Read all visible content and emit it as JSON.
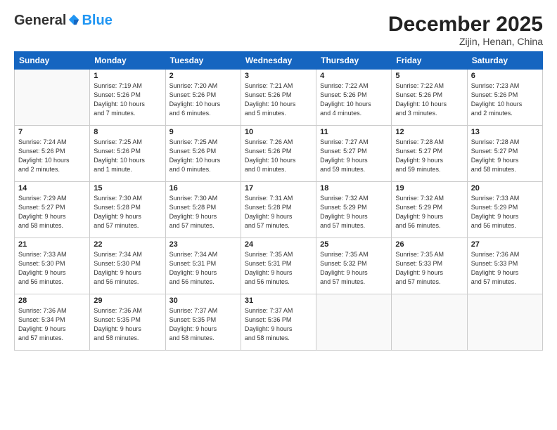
{
  "header": {
    "logo_general": "General",
    "logo_blue": "Blue",
    "month": "December 2025",
    "location": "Zijin, Henan, China"
  },
  "weekdays": [
    "Sunday",
    "Monday",
    "Tuesday",
    "Wednesday",
    "Thursday",
    "Friday",
    "Saturday"
  ],
  "weeks": [
    [
      {
        "day": "",
        "info": ""
      },
      {
        "day": "1",
        "info": "Sunrise: 7:19 AM\nSunset: 5:26 PM\nDaylight: 10 hours\nand 7 minutes."
      },
      {
        "day": "2",
        "info": "Sunrise: 7:20 AM\nSunset: 5:26 PM\nDaylight: 10 hours\nand 6 minutes."
      },
      {
        "day": "3",
        "info": "Sunrise: 7:21 AM\nSunset: 5:26 PM\nDaylight: 10 hours\nand 5 minutes."
      },
      {
        "day": "4",
        "info": "Sunrise: 7:22 AM\nSunset: 5:26 PM\nDaylight: 10 hours\nand 4 minutes."
      },
      {
        "day": "5",
        "info": "Sunrise: 7:22 AM\nSunset: 5:26 PM\nDaylight: 10 hours\nand 3 minutes."
      },
      {
        "day": "6",
        "info": "Sunrise: 7:23 AM\nSunset: 5:26 PM\nDaylight: 10 hours\nand 2 minutes."
      }
    ],
    [
      {
        "day": "7",
        "info": "Sunrise: 7:24 AM\nSunset: 5:26 PM\nDaylight: 10 hours\nand 2 minutes."
      },
      {
        "day": "8",
        "info": "Sunrise: 7:25 AM\nSunset: 5:26 PM\nDaylight: 10 hours\nand 1 minute."
      },
      {
        "day": "9",
        "info": "Sunrise: 7:25 AM\nSunset: 5:26 PM\nDaylight: 10 hours\nand 0 minutes."
      },
      {
        "day": "10",
        "info": "Sunrise: 7:26 AM\nSunset: 5:26 PM\nDaylight: 10 hours\nand 0 minutes."
      },
      {
        "day": "11",
        "info": "Sunrise: 7:27 AM\nSunset: 5:27 PM\nDaylight: 9 hours\nand 59 minutes."
      },
      {
        "day": "12",
        "info": "Sunrise: 7:28 AM\nSunset: 5:27 PM\nDaylight: 9 hours\nand 59 minutes."
      },
      {
        "day": "13",
        "info": "Sunrise: 7:28 AM\nSunset: 5:27 PM\nDaylight: 9 hours\nand 58 minutes."
      }
    ],
    [
      {
        "day": "14",
        "info": "Sunrise: 7:29 AM\nSunset: 5:27 PM\nDaylight: 9 hours\nand 58 minutes."
      },
      {
        "day": "15",
        "info": "Sunrise: 7:30 AM\nSunset: 5:28 PM\nDaylight: 9 hours\nand 57 minutes."
      },
      {
        "day": "16",
        "info": "Sunrise: 7:30 AM\nSunset: 5:28 PM\nDaylight: 9 hours\nand 57 minutes."
      },
      {
        "day": "17",
        "info": "Sunrise: 7:31 AM\nSunset: 5:28 PM\nDaylight: 9 hours\nand 57 minutes."
      },
      {
        "day": "18",
        "info": "Sunrise: 7:32 AM\nSunset: 5:29 PM\nDaylight: 9 hours\nand 57 minutes."
      },
      {
        "day": "19",
        "info": "Sunrise: 7:32 AM\nSunset: 5:29 PM\nDaylight: 9 hours\nand 56 minutes."
      },
      {
        "day": "20",
        "info": "Sunrise: 7:33 AM\nSunset: 5:29 PM\nDaylight: 9 hours\nand 56 minutes."
      }
    ],
    [
      {
        "day": "21",
        "info": "Sunrise: 7:33 AM\nSunset: 5:30 PM\nDaylight: 9 hours\nand 56 minutes."
      },
      {
        "day": "22",
        "info": "Sunrise: 7:34 AM\nSunset: 5:30 PM\nDaylight: 9 hours\nand 56 minutes."
      },
      {
        "day": "23",
        "info": "Sunrise: 7:34 AM\nSunset: 5:31 PM\nDaylight: 9 hours\nand 56 minutes."
      },
      {
        "day": "24",
        "info": "Sunrise: 7:35 AM\nSunset: 5:31 PM\nDaylight: 9 hours\nand 56 minutes."
      },
      {
        "day": "25",
        "info": "Sunrise: 7:35 AM\nSunset: 5:32 PM\nDaylight: 9 hours\nand 57 minutes."
      },
      {
        "day": "26",
        "info": "Sunrise: 7:35 AM\nSunset: 5:33 PM\nDaylight: 9 hours\nand 57 minutes."
      },
      {
        "day": "27",
        "info": "Sunrise: 7:36 AM\nSunset: 5:33 PM\nDaylight: 9 hours\nand 57 minutes."
      }
    ],
    [
      {
        "day": "28",
        "info": "Sunrise: 7:36 AM\nSunset: 5:34 PM\nDaylight: 9 hours\nand 57 minutes."
      },
      {
        "day": "29",
        "info": "Sunrise: 7:36 AM\nSunset: 5:35 PM\nDaylight: 9 hours\nand 58 minutes."
      },
      {
        "day": "30",
        "info": "Sunrise: 7:37 AM\nSunset: 5:35 PM\nDaylight: 9 hours\nand 58 minutes."
      },
      {
        "day": "31",
        "info": "Sunrise: 7:37 AM\nSunset: 5:36 PM\nDaylight: 9 hours\nand 58 minutes."
      },
      {
        "day": "",
        "info": ""
      },
      {
        "day": "",
        "info": ""
      },
      {
        "day": "",
        "info": ""
      }
    ]
  ]
}
